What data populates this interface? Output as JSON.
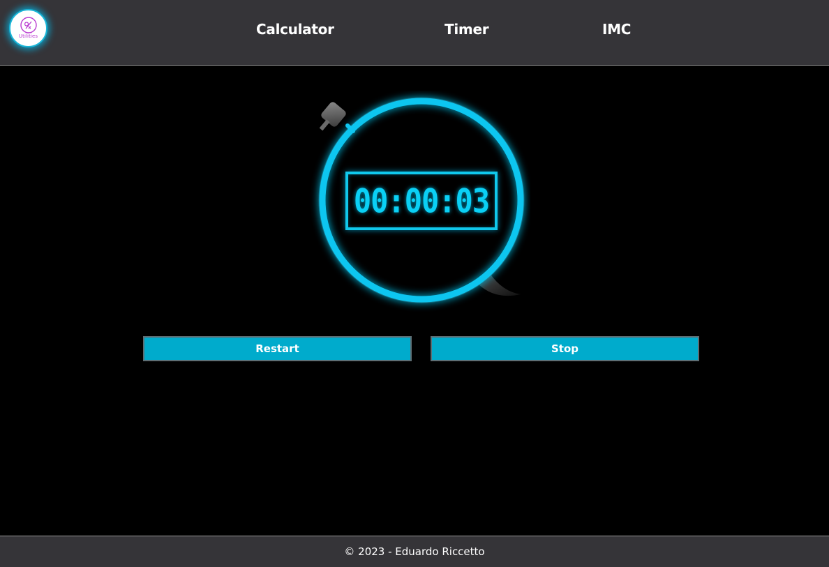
{
  "header": {
    "logo_text": "Utilities",
    "nav": [
      {
        "label": "Calculator"
      },
      {
        "label": "Timer"
      },
      {
        "label": "IMC"
      }
    ]
  },
  "timer": {
    "display": "00:00:03",
    "accent_color": "#10c8ec"
  },
  "controls": {
    "restart_label": "Restart",
    "stop_label": "Stop"
  },
  "footer": {
    "text": "© 2023 - Eduardo Riccetto"
  },
  "colors": {
    "header_bg": "#353438",
    "button_bg": "#00abcc",
    "page_bg": "#000000"
  },
  "icons": [
    "utilities-logo-icon",
    "stopwatch-icon"
  ]
}
